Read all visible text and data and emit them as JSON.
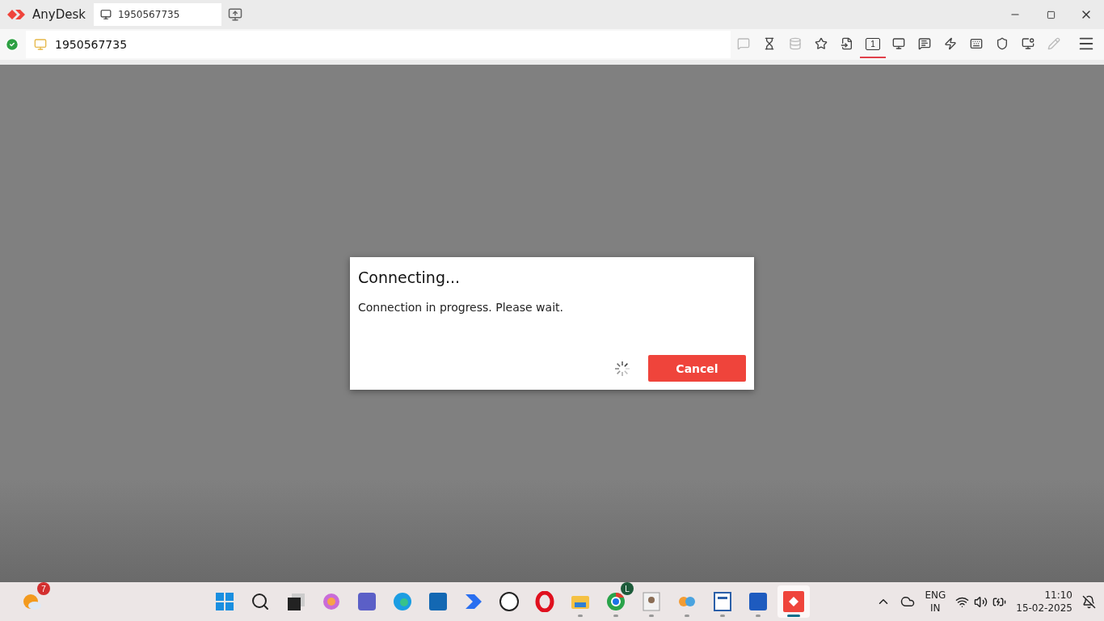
{
  "window": {
    "app_name": "AnyDesk",
    "tab_label": "1950567735"
  },
  "address_bar": {
    "connected": true,
    "value": "1950567735"
  },
  "toolbar": [
    {
      "kind": "chat-screen",
      "disabled": true,
      "selected": false
    },
    {
      "kind": "hourglass",
      "disabled": false,
      "selected": false
    },
    {
      "kind": "database",
      "disabled": true,
      "selected": false
    },
    {
      "kind": "star",
      "disabled": false,
      "selected": false
    },
    {
      "kind": "file-in",
      "disabled": false,
      "selected": false
    },
    {
      "kind": "display",
      "label": "1",
      "disabled": false,
      "selected": true
    },
    {
      "kind": "monitor",
      "disabled": false,
      "selected": false
    },
    {
      "kind": "chat",
      "disabled": false,
      "selected": false
    },
    {
      "kind": "lightning",
      "disabled": false,
      "selected": false
    },
    {
      "kind": "keyboard",
      "disabled": false,
      "selected": false
    },
    {
      "kind": "shield",
      "disabled": false,
      "selected": false
    },
    {
      "kind": "record",
      "disabled": false,
      "selected": false
    },
    {
      "kind": "pencil",
      "disabled": true,
      "selected": false
    },
    {
      "kind": "menu",
      "disabled": false,
      "selected": false
    }
  ],
  "dialog": {
    "title": "Connecting...",
    "message": "Connection in progress. Please wait.",
    "button": "Cancel"
  },
  "taskbar": {
    "weather_badge": "7",
    "apps": [
      {
        "kind": "start",
        "running": false,
        "selected": false
      },
      {
        "kind": "search",
        "running": false,
        "selected": false
      },
      {
        "kind": "task-view",
        "running": false,
        "selected": false
      },
      {
        "kind": "copilot",
        "running": false,
        "selected": false
      },
      {
        "kind": "teams",
        "running": false,
        "selected": false
      },
      {
        "kind": "edge",
        "running": false,
        "selected": false
      },
      {
        "kind": "store",
        "running": false,
        "selected": false
      },
      {
        "kind": "automate",
        "running": false,
        "selected": false
      },
      {
        "kind": "dell",
        "running": false,
        "selected": false
      },
      {
        "kind": "opera",
        "running": false,
        "selected": false
      },
      {
        "kind": "folder",
        "running": true,
        "selected": false
      },
      {
        "kind": "chrome",
        "badge": "L",
        "running": true,
        "selected": false
      },
      {
        "kind": "contact",
        "running": true,
        "selected": false
      },
      {
        "kind": "balloons",
        "running": true,
        "selected": false
      },
      {
        "kind": "editor",
        "running": true,
        "selected": false
      },
      {
        "kind": "word",
        "running": true,
        "selected": false
      },
      {
        "kind": "anydesk",
        "running": true,
        "selected": true
      }
    ],
    "language": "ENG",
    "region": "IN",
    "time": "11:10",
    "date": "15-02-2025"
  }
}
